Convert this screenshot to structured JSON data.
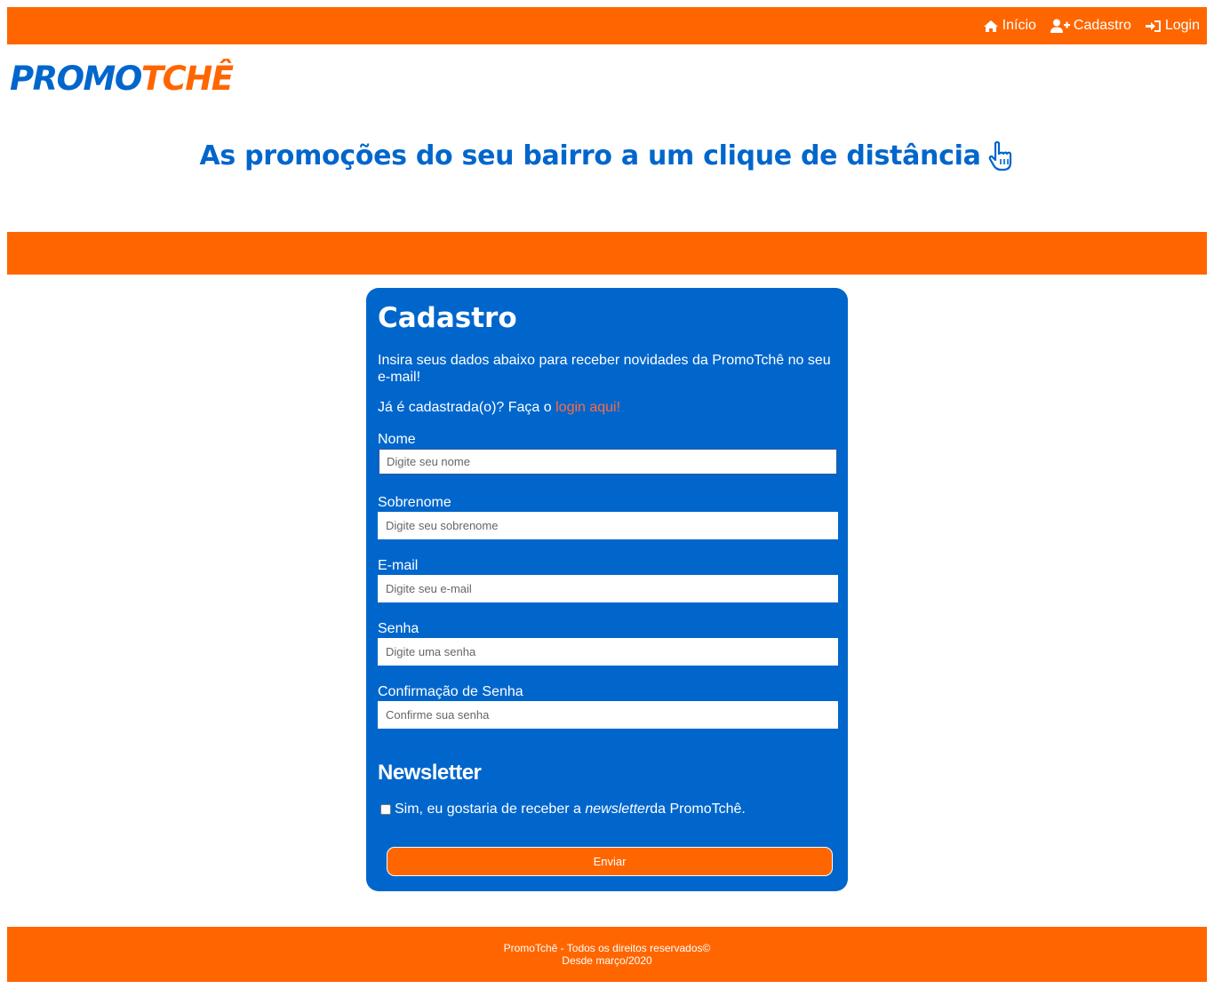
{
  "nav": {
    "items": [
      {
        "label": "Início",
        "icon": "home-icon"
      },
      {
        "label": "Cadastro",
        "icon": "user-plus-icon"
      },
      {
        "label": "Login",
        "icon": "sign-in-icon"
      }
    ]
  },
  "brand": {
    "logo_part1": "PROMO",
    "logo_part2": "TCHÊ",
    "primary_color": "#0066cc",
    "accent_color": "#ff6600"
  },
  "hero": {
    "tagline": "As promoções do seu bairro a um clique de distância",
    "icon": "pointing-hand-icon"
  },
  "form": {
    "title": "Cadastro",
    "intro": "Insira seus dados abaixo para receber novidades da PromoTchê no seu e-mail!",
    "already_text": "Já é cadastrada(o)? Faça o ",
    "login_link": "login aqui!",
    "fields": [
      {
        "label": "Nome",
        "placeholder": "Digite seu nome",
        "value": ""
      },
      {
        "label": "Sobrenome",
        "placeholder": "Digite seu sobrenome",
        "value": ""
      },
      {
        "label": "E-mail",
        "placeholder": "Digite seu e-mail",
        "value": ""
      },
      {
        "label": "Senha",
        "placeholder": "Digite uma senha",
        "value": ""
      },
      {
        "label": "Confirmação de Senha",
        "placeholder": "Confirme sua senha",
        "value": ""
      }
    ],
    "newsletter_title": "Newsletter",
    "newsletter_text_before": "Sim, eu gostaria de receber a ",
    "newsletter_text_em": "newsletter",
    "newsletter_text_after": " da PromoTchê.",
    "newsletter_checked": false,
    "submit_label": "Enviar"
  },
  "footer": {
    "line1": "PromoTchê - Todos os direitos reservados©",
    "line2": "Desde março/2020"
  }
}
